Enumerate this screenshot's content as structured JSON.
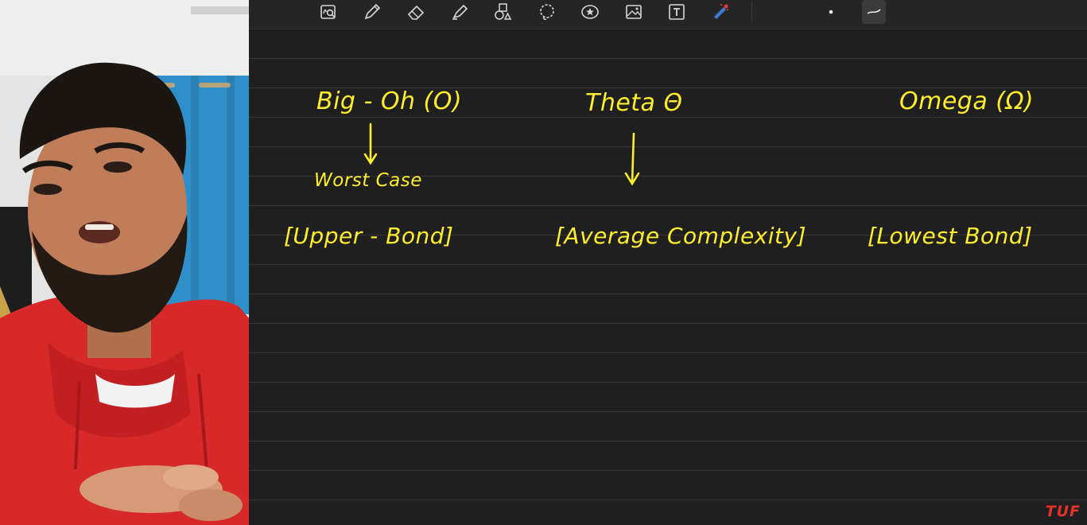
{
  "toolbar": {
    "tools": [
      {
        "name": "zoom-lens-icon"
      },
      {
        "name": "pen-icon"
      },
      {
        "name": "eraser-icon"
      },
      {
        "name": "highlighter-icon"
      },
      {
        "name": "shapes-icon"
      },
      {
        "name": "lasso-icon"
      },
      {
        "name": "sticker-icon"
      },
      {
        "name": "image-icon"
      },
      {
        "name": "text-box-icon"
      },
      {
        "name": "laser-pointer-icon"
      },
      {
        "name": "dot-pen-size-icon"
      },
      {
        "name": "stroke-style-icon"
      }
    ],
    "ink_color": "#ffee2e"
  },
  "notes": {
    "big_oh": "Big - Oh (O)",
    "worst_case": "Worst Case",
    "upper_bound": "[Upper - Bond]",
    "theta": "Theta Θ",
    "average_complexity": "[Average Complexity]",
    "omega": "Omega (Ω)",
    "lower_bound": "[Lowest Bond]"
  },
  "watermark": "TUF"
}
